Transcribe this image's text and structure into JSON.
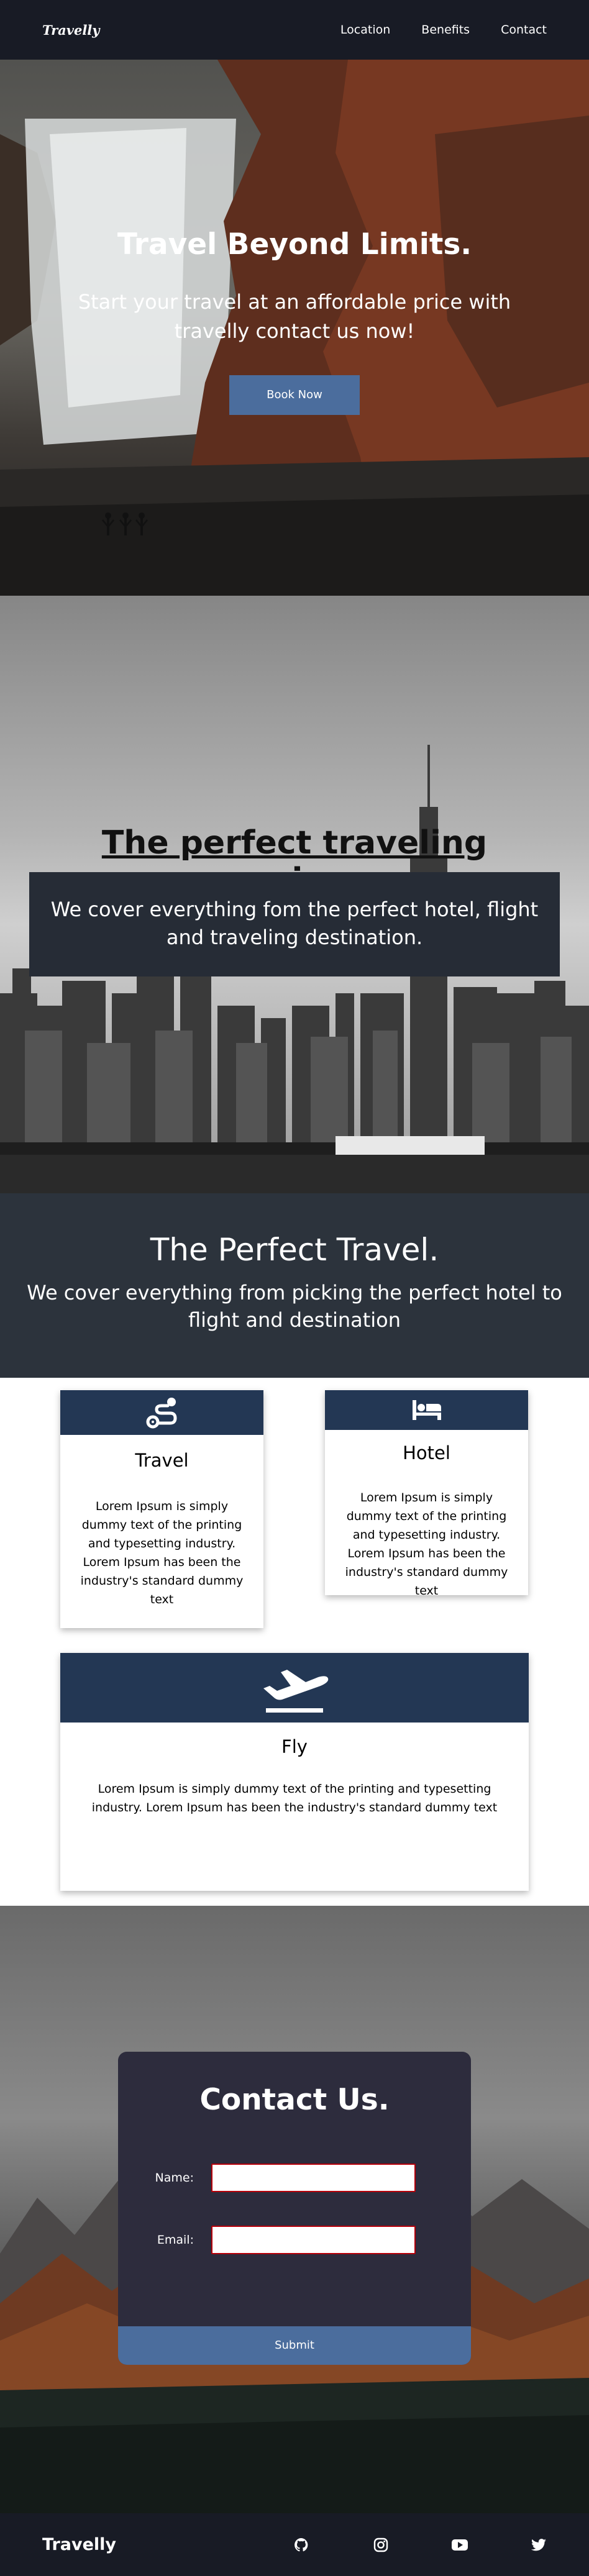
{
  "nav": {
    "logo": "Travelly",
    "links": [
      "Location",
      "Benefits",
      "Contact"
    ]
  },
  "hero": {
    "title": "Travel Beyond Limits.",
    "subtitle": "Start your travel at an affordable price with travelly contact us now!",
    "button": "Book Now"
  },
  "experience": {
    "title": "The perfect traveling experience.",
    "text": "We cover everything fom the perfect hotel, flight and traveling destination."
  },
  "perfect": {
    "title": "The Perfect Travel.",
    "text": "We cover everything from picking the perfect hotel to flight and destination"
  },
  "cards": [
    {
      "title": "Travel",
      "icon": "route-icon",
      "text": "Lorem Ipsum is simply dummy text of the printing and typesetting industry. Lorem Ipsum has been the industry's standard dummy text"
    },
    {
      "title": "Hotel",
      "icon": "bed-icon",
      "text": "Lorem Ipsum is simply dummy text of the printing and typesetting industry. Lorem Ipsum has been the industry's standard dummy text"
    },
    {
      "title": "Fly",
      "icon": "plane-departure-icon",
      "text": "Lorem Ipsum is simply dummy text of the printing and typesetting industry. Lorem Ipsum has been the industry's standard dummy text"
    }
  ],
  "contact": {
    "title": "Contact Us.",
    "name_label": "Name:",
    "email_label": "Email:",
    "name_value": "",
    "email_value": "",
    "submit": "Submit"
  },
  "footer": {
    "brand": "Travelly",
    "icons": [
      "github-icon",
      "instagram-icon",
      "youtube-icon",
      "twitter-icon"
    ]
  },
  "colors": {
    "navbar": "#181b25",
    "button": "#4b6d9d",
    "card_header": "#233754",
    "form_bg": "#2d2c3d",
    "input_border": "#b5000a"
  }
}
